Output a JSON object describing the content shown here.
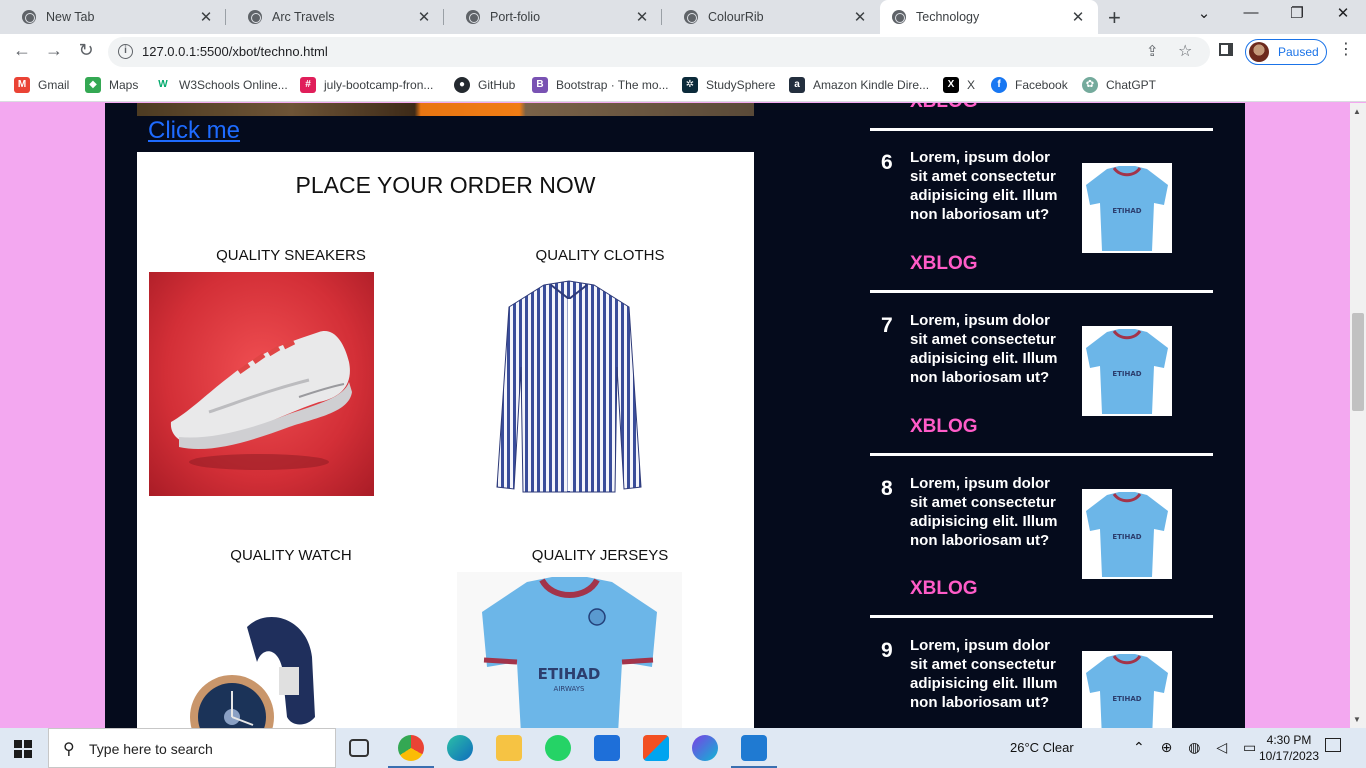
{
  "browser": {
    "tabs": [
      {
        "title": "New Tab",
        "active": false
      },
      {
        "title": "Arc Travels",
        "active": false
      },
      {
        "title": "Port-folio",
        "active": false
      },
      {
        "title": "ColourRib",
        "active": false
      },
      {
        "title": "Technology",
        "active": true
      }
    ],
    "new_tab_glyph": "+",
    "url": "127.0.0.1:5500/xbot/techno.html",
    "profile_label": "Paused",
    "bookmarks": [
      {
        "label": "Gmail",
        "icon": "gmail-icon",
        "color": "#ea4335"
      },
      {
        "label": "Maps",
        "icon": "maps-icon",
        "color": "#34a853"
      },
      {
        "label": "W3Schools Online...",
        "icon": "w3schools-icon",
        "color": "#04aa6d"
      },
      {
        "label": "july-bootcamp-fron...",
        "icon": "slack-icon",
        "color": "#e01e5a"
      },
      {
        "label": "GitHub",
        "icon": "github-icon",
        "color": "#24292f"
      },
      {
        "label": "Bootstrap · The mo...",
        "icon": "bootstrap-icon",
        "color": "#7952b3"
      },
      {
        "label": "StudySphere",
        "icon": "studysphere-icon",
        "color": "#0b2a3a"
      },
      {
        "label": "Amazon Kindle Dire...",
        "icon": "amazon-icon",
        "color": "#232f3e"
      },
      {
        "label": "X",
        "icon": "x-icon",
        "color": "#000000"
      },
      {
        "label": "Facebook",
        "icon": "facebook-icon",
        "color": "#1877f2"
      },
      {
        "label": "ChatGPT",
        "icon": "chatgpt-icon",
        "color": "#74aa9c"
      }
    ]
  },
  "page": {
    "click_me": "Click me",
    "order_title": "PLACE YOUR ORDER NOW",
    "products": [
      {
        "label": "QUALITY SNEAKERS"
      },
      {
        "label": "QUALITY CLOTHS"
      },
      {
        "label": "QUALITY WATCH"
      },
      {
        "label": "QUALITY JERSEYS"
      }
    ],
    "sidebar_top_tag": "XBLOG",
    "blog_items": [
      {
        "num": "6",
        "text": "Lorem, ipsum dolor sit amet consectetur adipisicing elit. Illum non laboriosam ut?",
        "tag": "XBLOG"
      },
      {
        "num": "7",
        "text": "Lorem, ipsum dolor sit amet consectetur adipisicing elit. Illum non laboriosam ut?",
        "tag": "XBLOG"
      },
      {
        "num": "8",
        "text": "Lorem, ipsum dolor sit amet consectetur adipisicing elit. Illum non laboriosam ut?",
        "tag": "XBLOG"
      },
      {
        "num": "9",
        "text": "Lorem, ipsum dolor sit amet consectetur adipisicing elit. Illum non laboriosam ut?",
        "tag": ""
      }
    ],
    "colors": {
      "background": "#f3a8f0",
      "dark_panel": "#050b1c",
      "tag_pink": "#ff5cc8",
      "link_blue": "#1e6bff"
    }
  },
  "taskbar": {
    "search_placeholder": "Type here to search",
    "weather": "26°C  Clear",
    "time": "4:30 PM",
    "date": "10/17/2023"
  }
}
